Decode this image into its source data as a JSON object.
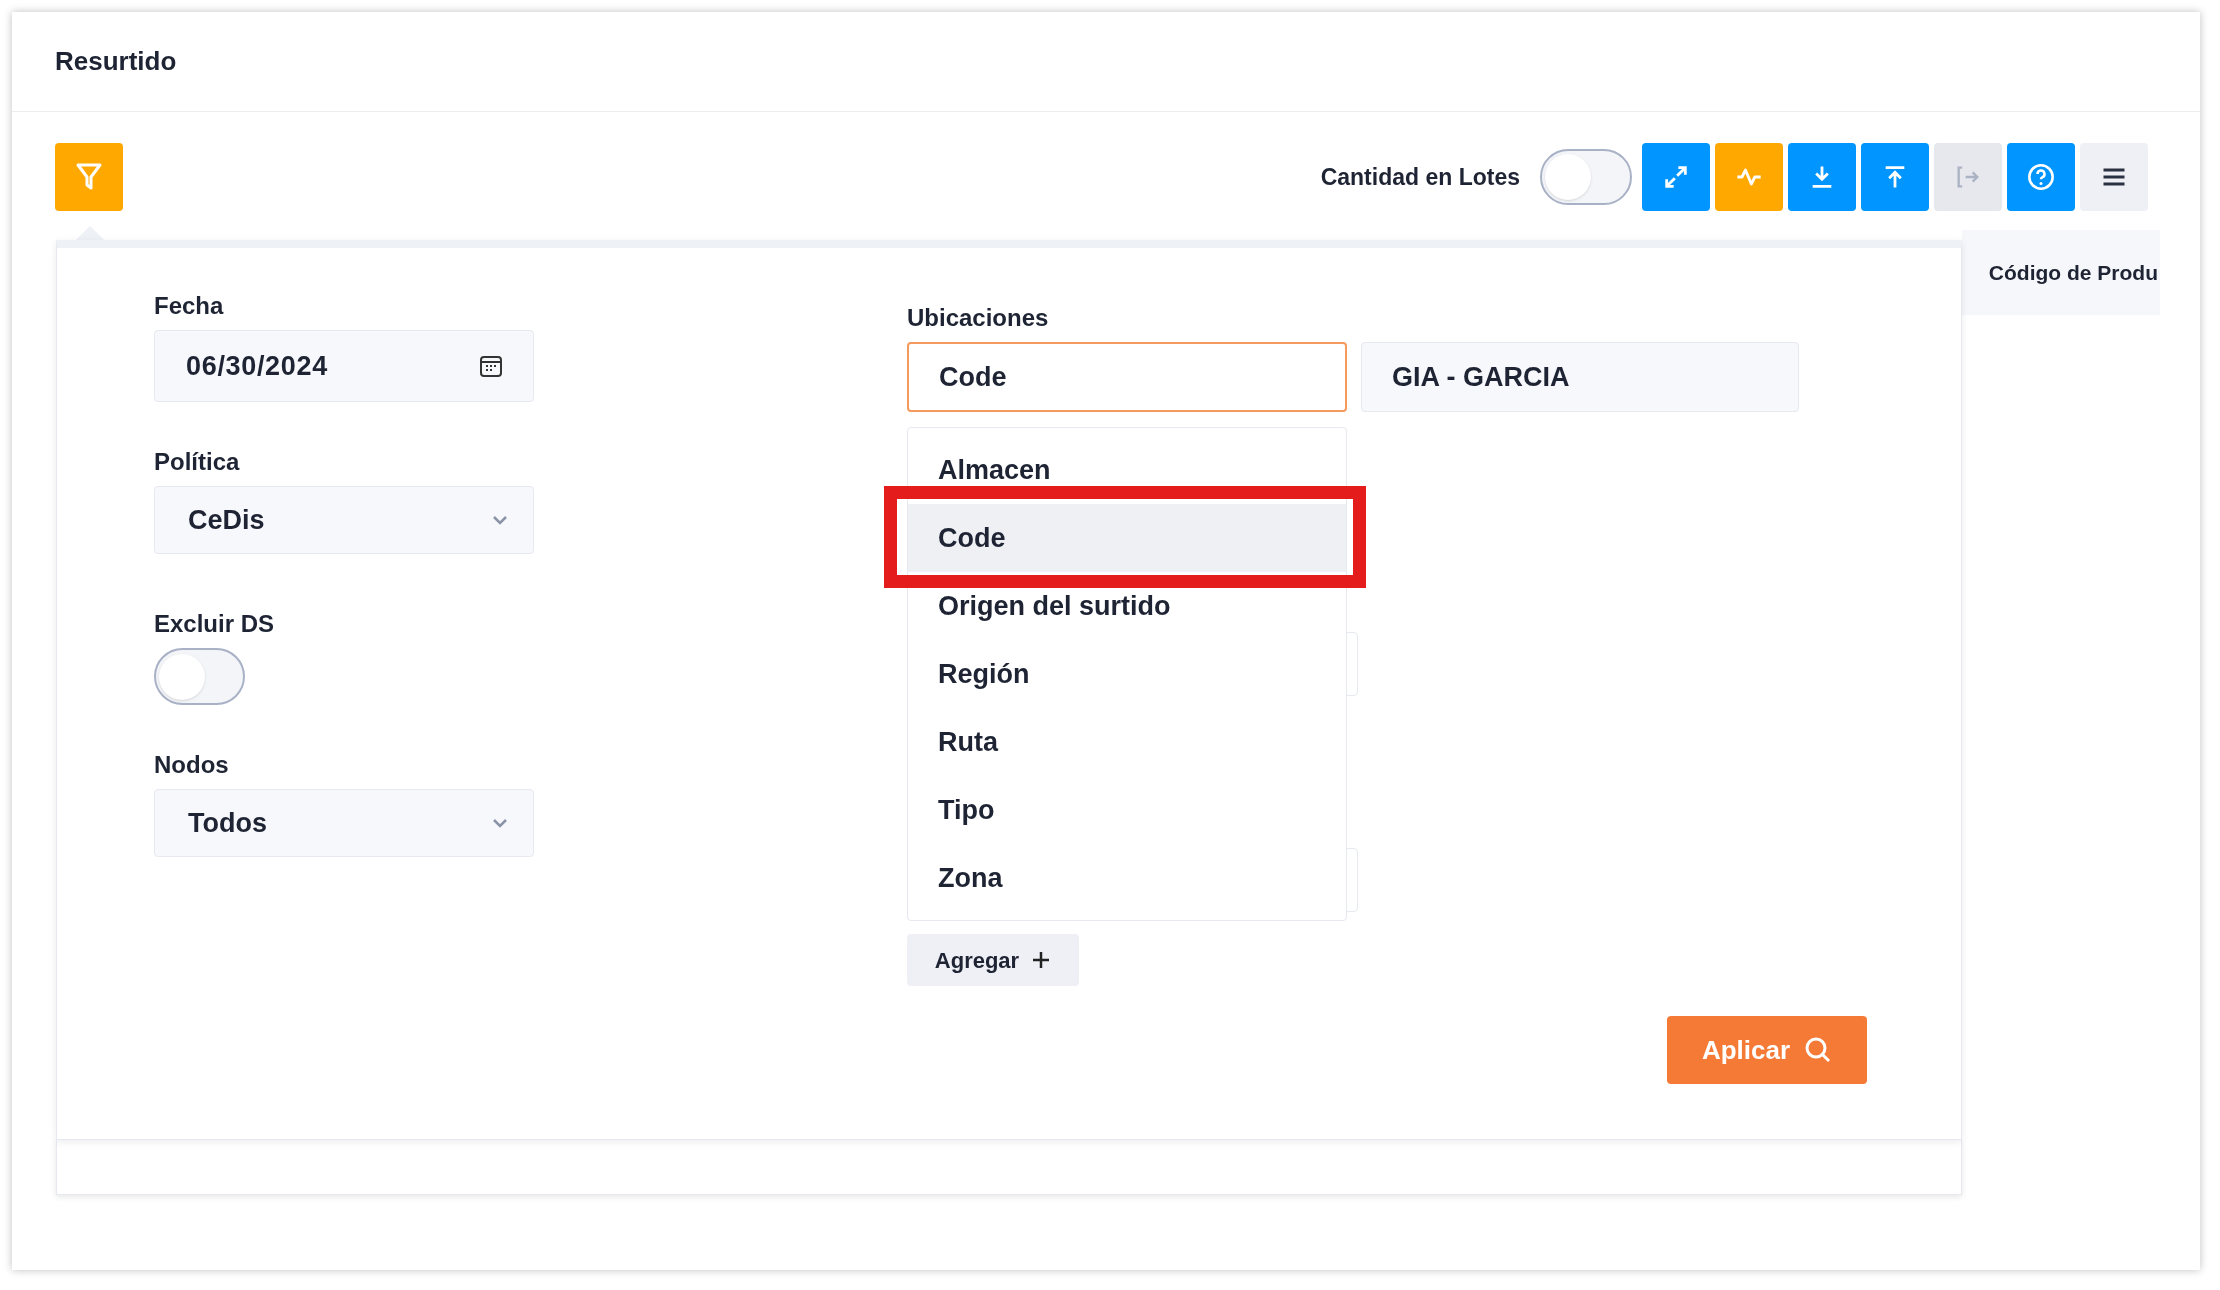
{
  "page": {
    "title": "Resurtido"
  },
  "toolbar": {
    "lotes_toggle": {
      "label": "Cantidad en Lotes",
      "on": false
    },
    "buttons": [
      {
        "kind": "expand",
        "color": "#0095ff",
        "disabled": false
      },
      {
        "kind": "pulse",
        "color": "#ffa800",
        "disabled": false
      },
      {
        "kind": "download",
        "color": "#0095ff",
        "disabled": false
      },
      {
        "kind": "upload",
        "color": "#0095ff",
        "disabled": false
      },
      {
        "kind": "export",
        "color": "#e6e8ee",
        "disabled": true
      },
      {
        "kind": "help",
        "color": "#0095ff",
        "disabled": false
      },
      {
        "kind": "menu",
        "color": "#eef0f5",
        "disabled": false
      }
    ]
  },
  "side_column": {
    "heading": "Código de Produ"
  },
  "filters": {
    "fecha": {
      "label": "Fecha",
      "value": "06/30/2024"
    },
    "politica": {
      "label": "Política",
      "value": "CeDis"
    },
    "excluir_ds": {
      "label": "Excluir DS",
      "on": false
    },
    "nodos": {
      "label": "Nodos",
      "value": "Todos"
    }
  },
  "ubicaciones": {
    "label": "Ubicaciones",
    "field": {
      "value": "Code",
      "focused": true
    },
    "value_field": {
      "value": "GIA - GARCIA"
    },
    "options": [
      {
        "label": "Almacen",
        "selected": false,
        "annotated": false
      },
      {
        "label": "Code",
        "selected": true,
        "annotated": true
      },
      {
        "label": "Origen del surtido",
        "selected": false,
        "annotated": false
      },
      {
        "label": "Región",
        "selected": false,
        "annotated": false
      },
      {
        "label": "Ruta",
        "selected": false,
        "annotated": false
      },
      {
        "label": "Tipo",
        "selected": false,
        "annotated": false
      },
      {
        "label": "Zona",
        "selected": false,
        "annotated": false
      }
    ],
    "add_button": "Agregar"
  },
  "apply_button": "Aplicar"
}
